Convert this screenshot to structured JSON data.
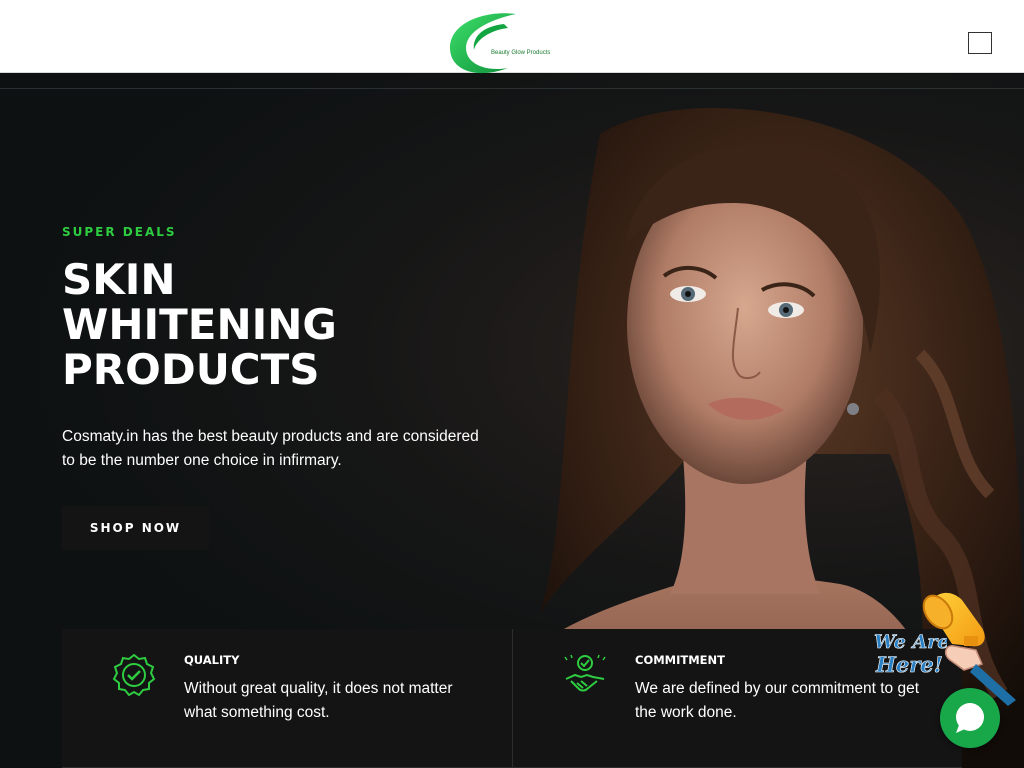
{
  "header": {
    "logo_text": "Beauty Glow Products",
    "logo_icon": "c-leaf-logo",
    "menu_icon": "hamburger-menu-icon"
  },
  "hero": {
    "eyebrow": "SUPER DEALS",
    "headline": [
      "SKIN",
      "WHITENING",
      "PRODUCTS"
    ],
    "description": "Cosmaty.in has the best beauty products and are considered to be the number one choice in infirmary.",
    "cta_label": "SHOP NOW"
  },
  "features": [
    {
      "icon": "badge-check-icon",
      "title": "QUALITY",
      "description": "Without great quality, it does not matter what something cost."
    },
    {
      "icon": "handshake-check-icon",
      "title": "COMMITMENT",
      "description": "We are defined by our commitment to get the work done."
    }
  ],
  "widgets": {
    "promo_text": "We Are Here!",
    "promo_icon": "megaphone-icon",
    "chat_icon": "chat-bubble-icon"
  },
  "colors": {
    "accent": "#2ecc40",
    "background": "#0d1112",
    "card": "#141414",
    "chat": "#18a84a"
  }
}
